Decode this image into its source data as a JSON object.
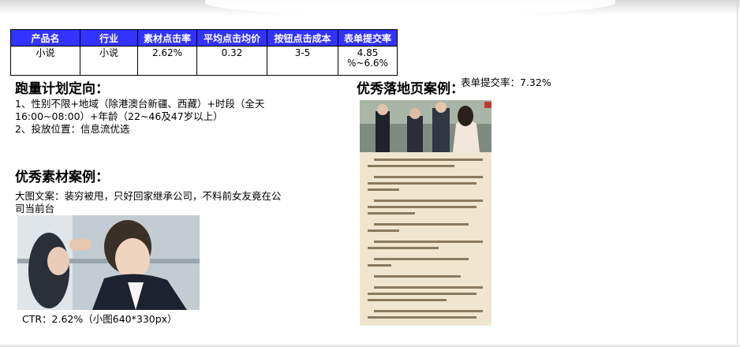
{
  "table": {
    "headers": [
      "产品名",
      "行业",
      "素材点击率",
      "平均点击均价",
      "按钮点击成本",
      "表单提交率"
    ],
    "row": [
      "小说",
      "小说",
      "2.62%",
      "0.32",
      "3-5",
      "4.85\n%~6.6%"
    ]
  },
  "targeting": {
    "title": "跑量计划定向：",
    "line1": "1、性别不限+地域（除港澳台新疆、西藏）+时段（全天",
    "line2": "16:00~08:00）+年龄（22~46及47岁以上）",
    "line3": "2、投放位置：信息流优选"
  },
  "creative": {
    "title": "优秀素材案例：",
    "caption_line1": "大图文案：装穷被甩，只好回家继承公司，不料前女友竟在公",
    "caption_line2": "司当前台",
    "ctr": "CTR：2.62%（小图640*330px）"
  },
  "landing": {
    "title": "优秀落地页案例：",
    "rate": "表单提交率：7.32%"
  },
  "colors": {
    "header_bg": "#3333ff",
    "header_text": "#ffffff",
    "page_bg": "#ffffff"
  }
}
